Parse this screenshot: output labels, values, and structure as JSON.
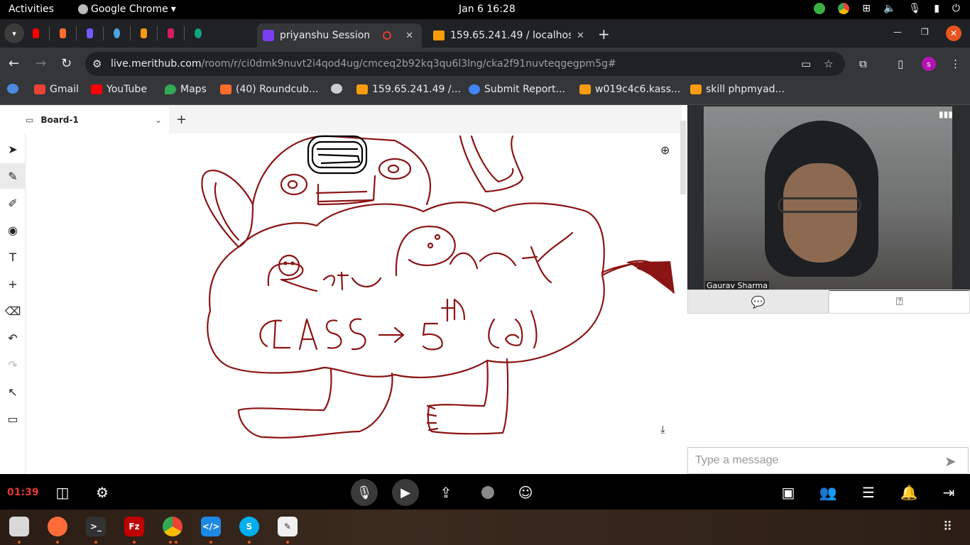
{
  "system": {
    "activities": "Activities",
    "app_name": "Google Chrome",
    "clock": "Jan 6  16:28"
  },
  "browser": {
    "tabs": [
      {
        "label": "priyanshu Session",
        "active": true
      },
      {
        "label": "159.65.241.49 / localhost",
        "active": false
      }
    ],
    "url_host": "live.merithub.com",
    "url_path": "/room/r/ci0dmk9nuvt2i4qod4ug/cmceq2b92kq3qu6l3lng/cka2f91nuvteqgegpm5g#",
    "profile_initial": "s",
    "bookmarks": [
      {
        "label": "Gmail",
        "icon": "gmail-icon",
        "color": "#ea4335"
      },
      {
        "label": "YouTube",
        "icon": "youtube-icon",
        "color": "#ff0000"
      },
      {
        "label": "Maps",
        "icon": "maps-icon",
        "color": "#34a853"
      },
      {
        "label": "(40) Roundcub...",
        "icon": "cpanel-icon",
        "color": "#ff6c2c"
      },
      {
        "label": "159.65.241.49 /...",
        "icon": "phpmyadmin-icon",
        "color": "#f89c0e"
      },
      {
        "label": "Submit Report...",
        "icon": "report-icon",
        "color": "#4285f4"
      },
      {
        "label": "w019c4c6.kass...",
        "icon": "phpmyadmin-icon",
        "color": "#f89c0e"
      },
      {
        "label": "skill phpmyad...",
        "icon": "phpmyadmin-icon",
        "color": "#f89c0e"
      }
    ]
  },
  "whiteboard": {
    "board_tab": "Board-1",
    "ink_color": "#8b1414"
  },
  "video": {
    "participant_name": "Gaurav Sharma"
  },
  "chat": {
    "placeholder": "Type a message"
  },
  "session": {
    "timer": "01:39"
  },
  "colors": {
    "accent_red": "#e53935",
    "ubuntu_orange": "#e95420"
  }
}
